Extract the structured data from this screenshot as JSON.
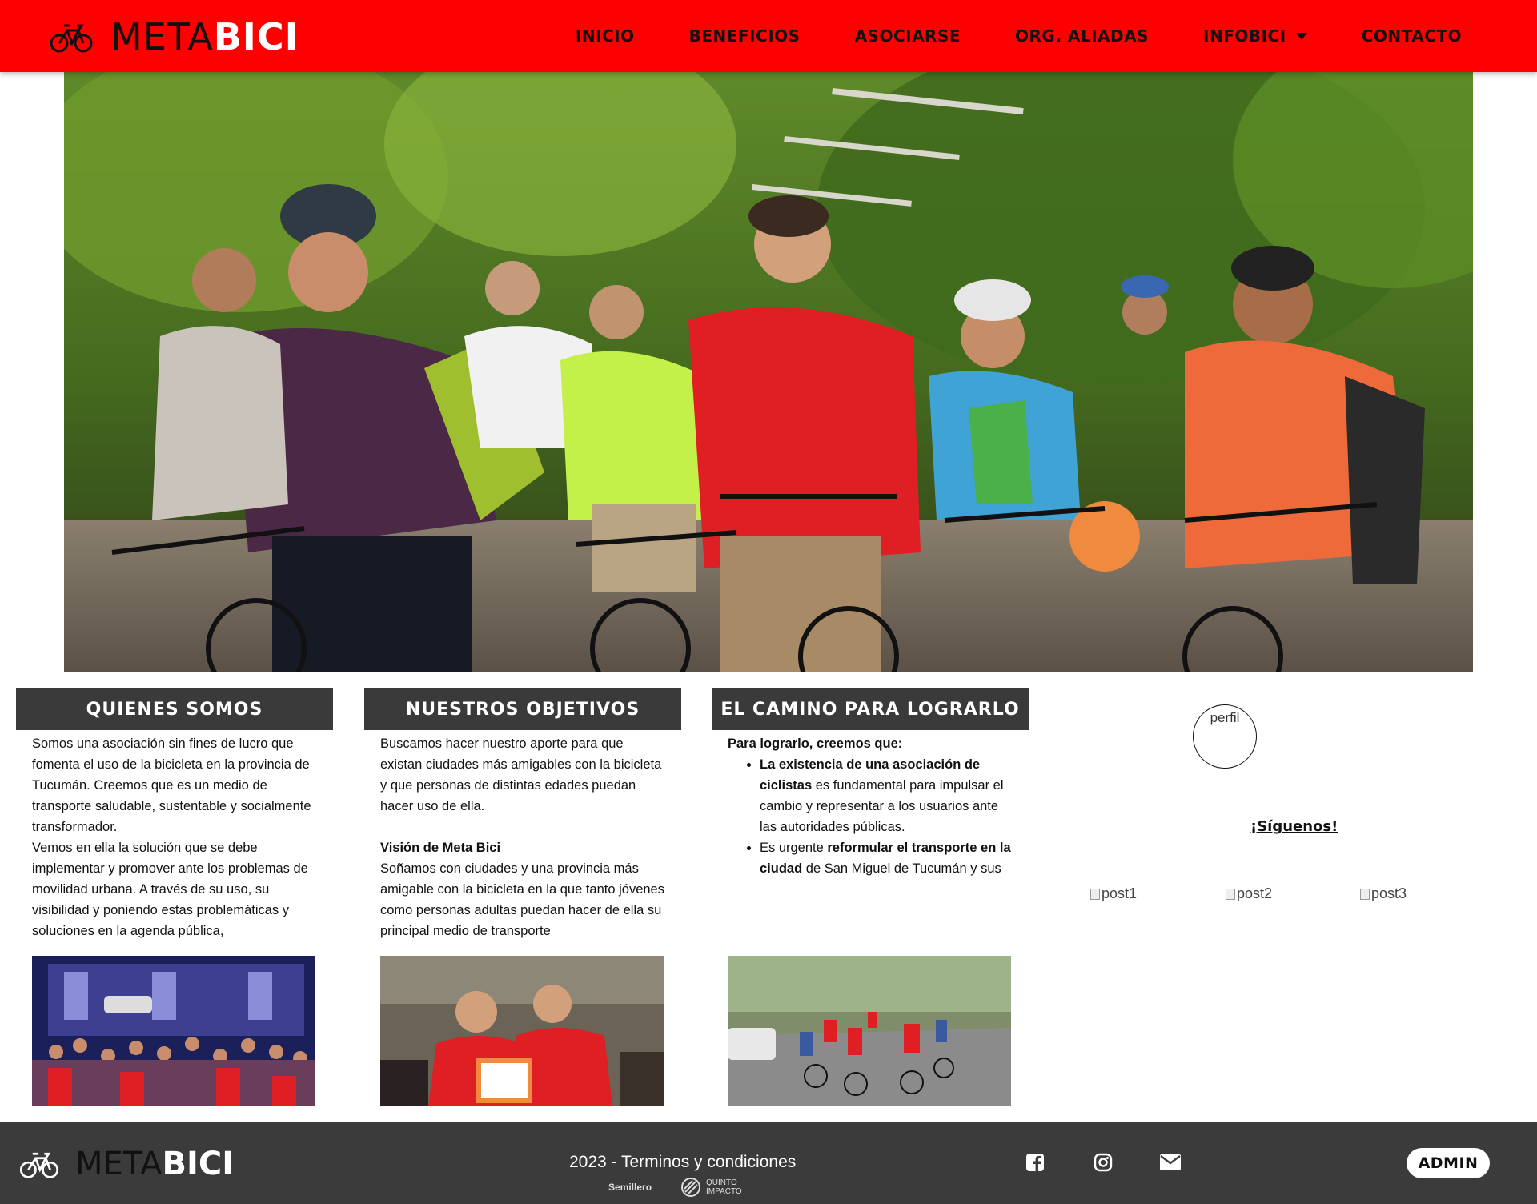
{
  "brand": {
    "meta": "META",
    "bici": "BICI"
  },
  "nav": {
    "items": [
      {
        "label": "INICIO"
      },
      {
        "label": "BENEFICIOS"
      },
      {
        "label": "ASOCIARSE"
      },
      {
        "label": "ORG. ALIADAS"
      },
      {
        "label": "INFOBICI"
      },
      {
        "label": "CONTACTO"
      }
    ]
  },
  "columns": {
    "quienes": {
      "title": "QUIENES SOMOS",
      "p1": "Somos una asociación sin fines de lucro que fomenta el uso de la bicicleta en la provincia de Tucumán. Creemos que es un medio de transporte saludable, sustentable y socialmente transformador.",
      "p2": "Vemos en ella la solución que se debe implementar y promover ante los problemas de movilidad urbana. A través de su uso, su visibilidad y poniendo estas problemáticas y soluciones en la agenda pública,"
    },
    "objetivos": {
      "title": "NUESTROS OBJETIVOS",
      "p1": "Buscamos hacer nuestro aporte para que existan ciudades más amigables con la bicicleta y que personas de distintas edades puedan hacer uso de ella.",
      "vision_title": "Visión de Meta Bici",
      "p2": "Soñamos con ciudades y una provincia más amigable con la bicicleta en la que tanto jóvenes como personas adultas puedan hacer de ella su principal medio de transporte"
    },
    "camino": {
      "title": "EL CAMINO PARA LOGRARLO",
      "intro": "Para lograrlo, creemos que:",
      "b1_bold": "La existencia de una asociación de ciclistas",
      "b1_rest": " es fundamental para impulsar el cambio y representar a los usuarios ante las autoridades públicas.",
      "b2_pre": "Es urgente ",
      "b2_bold": "reformular el transporte en la ciudad",
      "b2_rest": " de San Miguel de Tucumán y sus"
    }
  },
  "social": {
    "avatar_alt": "perfil",
    "follow": "¡Síguenos!",
    "posts": [
      "post1",
      "post2",
      "post3"
    ]
  },
  "footer": {
    "copyright": "2023 - Terminos y condiciones",
    "partner1": "Semillero",
    "partner2a": "QUINTO",
    "partner2b": "IMPACTO",
    "admin": "ADMIN"
  },
  "colors": {
    "brand_red": "#ff0000",
    "dark": "#3a3a3a"
  }
}
